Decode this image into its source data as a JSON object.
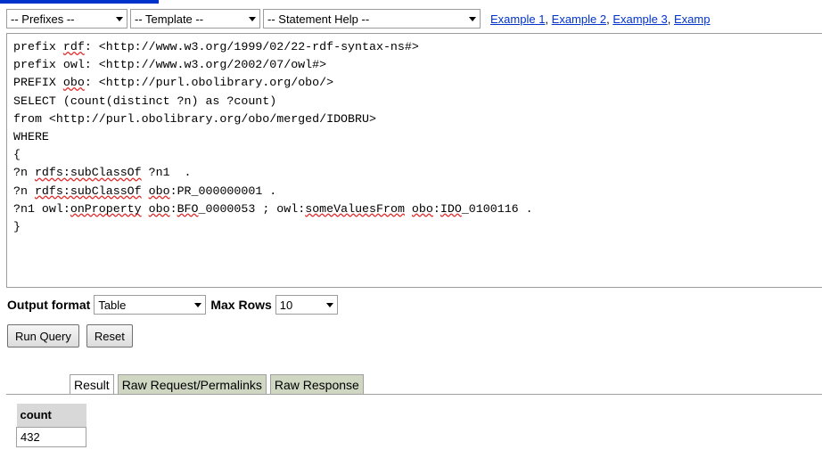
{
  "toolbar": {
    "prefixes": "-- Prefixes --",
    "template": "-- Template --",
    "statement_help": "-- Statement Help --",
    "examples": [
      "Example 1",
      "Example 2",
      "Example 3",
      "Examp"
    ],
    "separator": ", "
  },
  "editor": {
    "lines": [
      "prefix rdf: <http://www.w3.org/1999/02/22-rdf-syntax-ns#>",
      "prefix owl: <http://www.w3.org/2002/07/owl#>",
      "PREFIX obo: <http://purl.obolibrary.org/obo/>",
      "SELECT (count(distinct ?n) as ?count)",
      "from <http://purl.obolibrary.org/obo/merged/IDOBRU>",
      "WHERE",
      "{",
      "?n rdfs:subClassOf ?n1  .",
      "?n rdfs:subClassOf obo:PR_000000001 .",
      "?n1 owl:onProperty obo:BFO_0000053 ; owl:someValuesFrom obo:IDO_0100116 .",
      "}"
    ]
  },
  "options": {
    "output_format_label": "Output format",
    "output_format_value": "Table",
    "max_rows_label": "Max Rows",
    "max_rows_value": "10"
  },
  "buttons": {
    "run_query": "Run Query",
    "reset": "Reset"
  },
  "tabs": [
    {
      "label": "Result",
      "active": true
    },
    {
      "label": "Raw Request/Permalinks",
      "active": false
    },
    {
      "label": "Raw Response",
      "active": false
    }
  ],
  "result_table": {
    "header": "count",
    "value": "432"
  }
}
